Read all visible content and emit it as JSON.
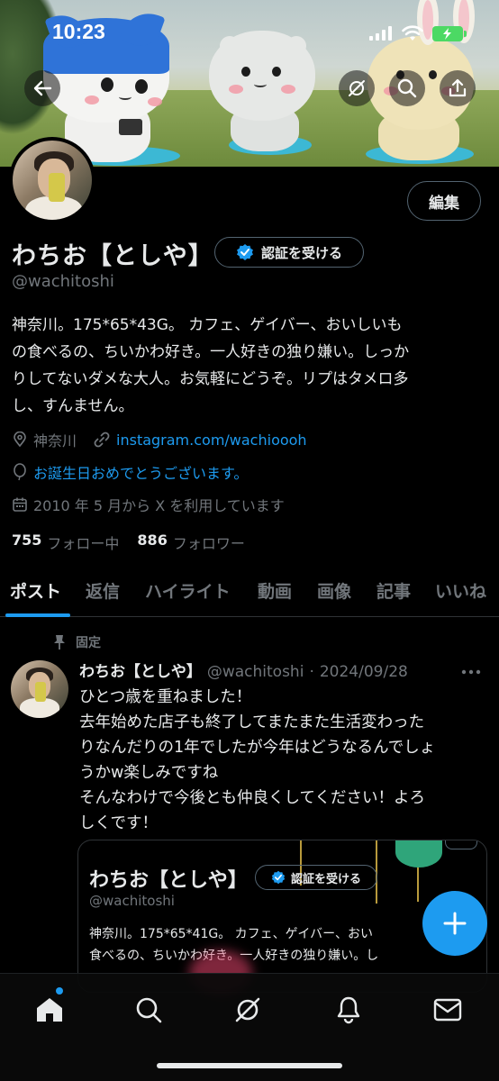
{
  "status_bar": {
    "time": "10:23"
  },
  "profile": {
    "display_name": "わちお【としや】",
    "verify_label": "認証を受ける",
    "handle": "@wachitoshi",
    "edit_label": "編集",
    "bio_lines": [
      "神奈川。175*65*43G。 カフェ、ゲイバー、おいしいも",
      "の食べるの、ちいかわ好き。一人好きの独り嫌い。しっか",
      "りしてないダメな大人。お気軽にどうぞ。リプはタメロ多",
      "し、すんません。"
    ],
    "location": "神奈川",
    "link": "instagram.com/wachioooh",
    "birthday": "お誕生日おめでとうございます。",
    "joined": "2010 年 5 月から X を利用しています",
    "following_count": "755",
    "following_label": "フォロー中",
    "followers_count": "886",
    "followers_label": "フォロワー"
  },
  "tabs": [
    "ポスト",
    "返信",
    "ハイライト",
    "動画",
    "画像",
    "記事",
    "いいね"
  ],
  "active_tab": "ポスト",
  "post": {
    "pinned_label": "固定",
    "name": "わちお【としや】",
    "handle": "@wachitoshi",
    "separator": "·",
    "date": "2024/09/28",
    "text_lines": [
      "ひとつ歳を重ねました！",
      "去年始めた店子も終了してまたまた生活変わった",
      "りなんだりの1年でしたが今年はどうなるんでしょ",
      "うかw楽しみですね",
      "そんなわけで今後とも仲良くしてください！よろ",
      "しくです！"
    ],
    "embed": {
      "name": "わちお【としや】",
      "verify_label": "認証を受ける",
      "handle": "@wachitoshi",
      "bio_lines": [
        "神奈川。175*65*41G。 カフェ、ゲイバー、おい",
        "食べるの、ちいかわ好き。一人好きの独り嫌い。し"
      ]
    }
  },
  "bottom_nav": [
    "home-icon",
    "search-icon",
    "grok-icon",
    "notifications-icon",
    "messages-icon"
  ],
  "colors": {
    "accent": "#1d9bf0",
    "background": "#000000",
    "muted": "#71767b",
    "text": "#e7e9ea"
  }
}
